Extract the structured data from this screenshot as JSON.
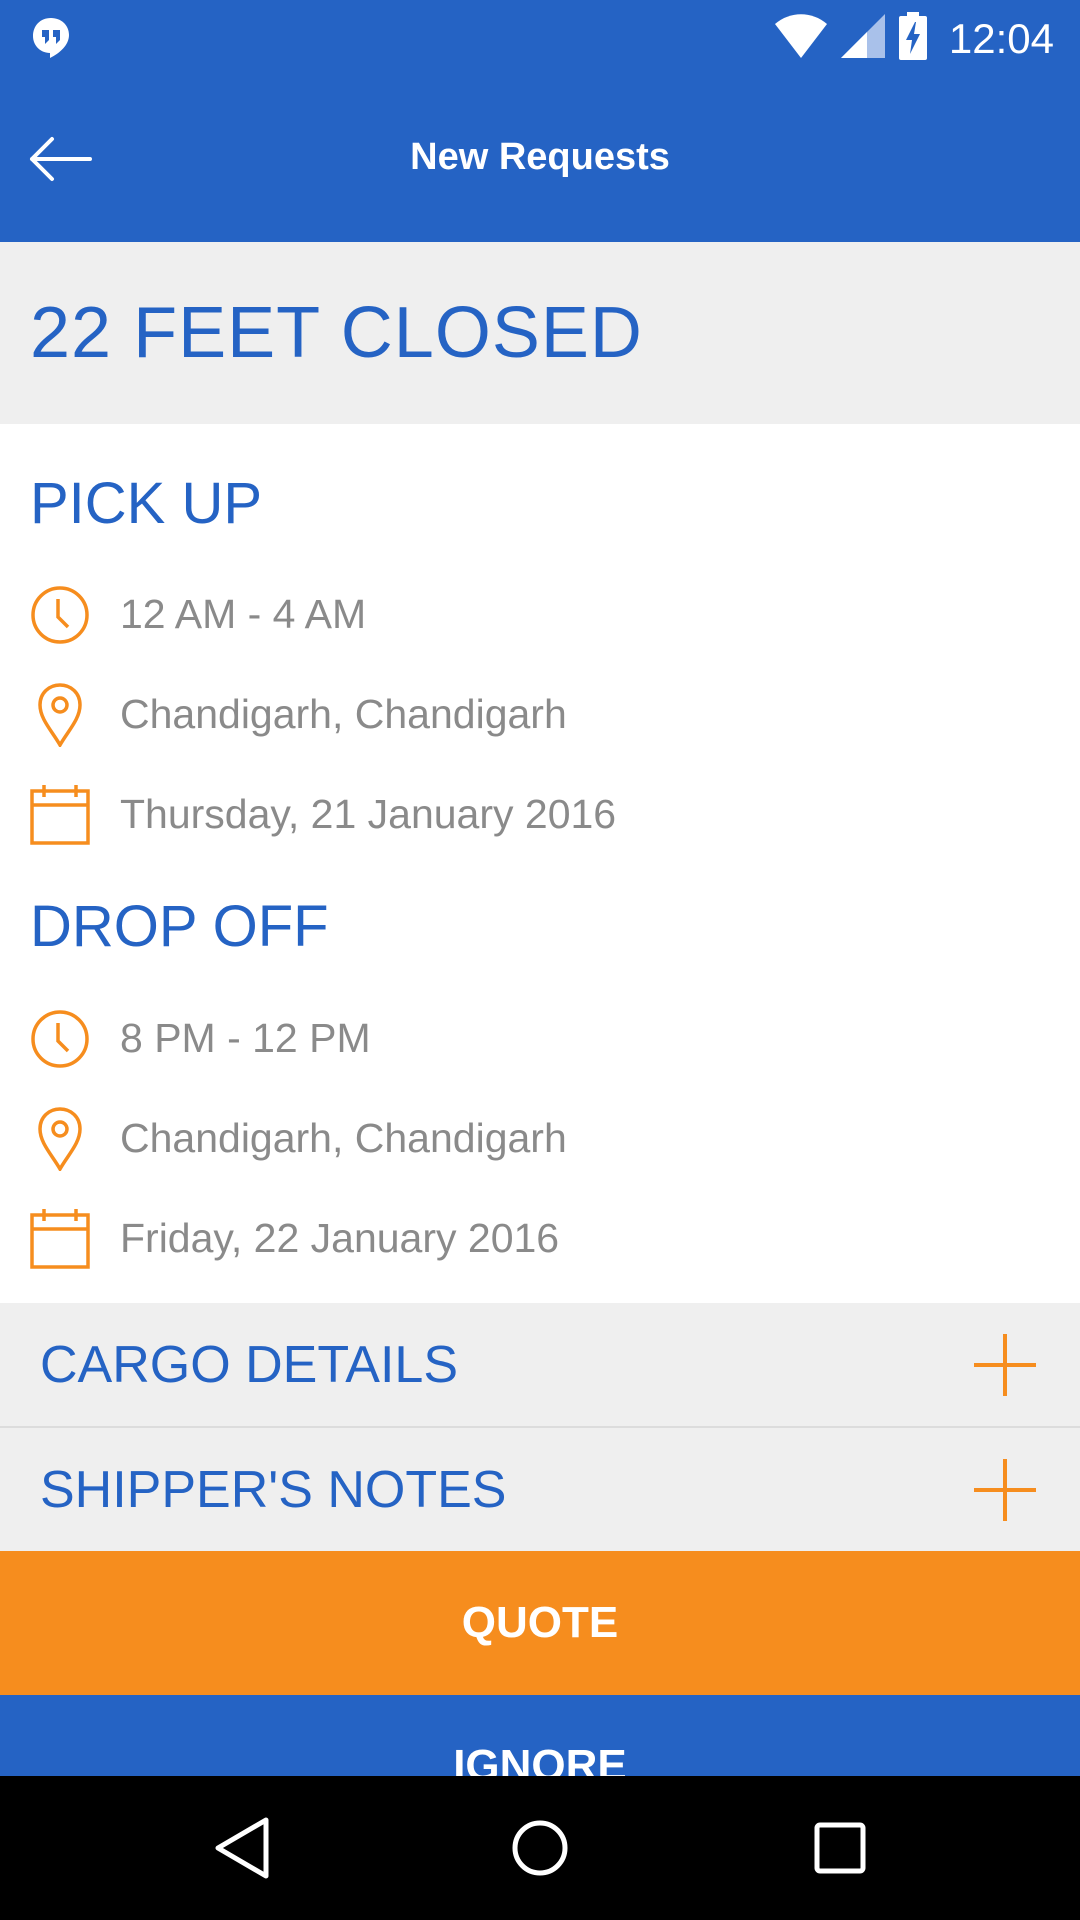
{
  "status_bar": {
    "time": "12:04",
    "icons": [
      "hangouts-icon",
      "wifi-icon",
      "signal-icon",
      "battery-charging-icon"
    ]
  },
  "app_bar": {
    "title": "New Requests",
    "back_icon": "arrow-left-icon"
  },
  "vehicle": {
    "name": "22 FEET CLOSED"
  },
  "pickup": {
    "heading": "PICK UP",
    "time": "12 AM - 4 AM",
    "location": "Chandigarh, Chandigarh",
    "date": "Thursday, 21 January 2016"
  },
  "dropoff": {
    "heading": "DROP OFF",
    "time": "8 PM - 12 PM",
    "location": "Chandigarh, Chandigarh",
    "date": "Friday, 22 January 2016"
  },
  "accordions": {
    "cargo_label": "CARGO DETAILS",
    "notes_label": "SHIPPER'S NOTES"
  },
  "actions": {
    "quote_label": "QUOTE",
    "ignore_label": "IGNORE"
  },
  "colors": {
    "primary": "#2563c4",
    "accent": "#f68d1e",
    "muted_text": "#8a8a8a",
    "panel_bg": "#efefef"
  }
}
